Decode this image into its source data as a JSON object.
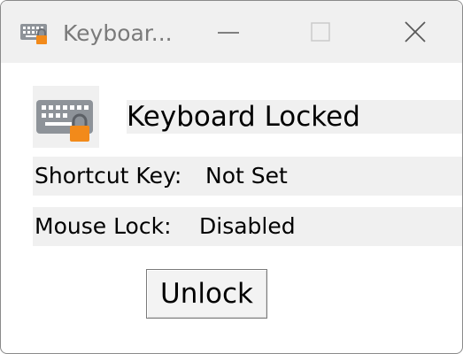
{
  "window": {
    "title": "Keyboar...",
    "controls": {
      "minimize": "minimize-icon",
      "maximize": "maximize-icon",
      "close": "close-icon"
    }
  },
  "header": {
    "app_icon": "keyboard-lock-icon",
    "status": "Keyboard Locked"
  },
  "info": [
    {
      "label": "Shortcut Key:",
      "value": "Not Set"
    },
    {
      "label": "Mouse Lock:",
      "value": "Disabled"
    }
  ],
  "actions": {
    "unlock_label": "Unlock"
  },
  "colors": {
    "titlebar_bg": "#f0f0f0",
    "band_bg": "#f0f0f0",
    "lock_accent": "#f28a1a",
    "keyboard_gray": "#8e9399"
  }
}
